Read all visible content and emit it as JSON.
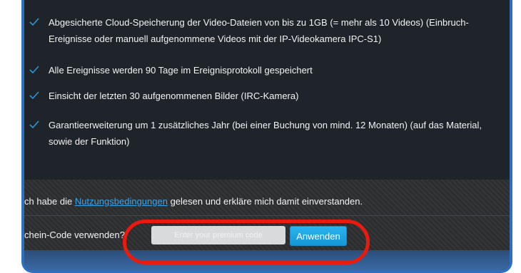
{
  "features": [
    {
      "icon": "checkmark-icon",
      "lines": [
        "Abgesicherte Cloud-Speicherung der Video-Dateien von bis zu 1GB (= mehr als 10 Videos) (Einbruch-",
        "Ereignisse oder manuell aufgenommene Videos mit der IP-Videokamera IPC-S1)"
      ]
    },
    {
      "icon": "checkmark-icon",
      "lines": [
        "Alle Ereignisse werden 90 Tage im Ereignisprotokoll gespeichert"
      ]
    },
    {
      "icon": "checkmark-icon",
      "lines": [
        "Einsicht der letzten 30 aufgenommenen Bilder (IRC-Kamera)"
      ]
    },
    {
      "icon": "checkmark-icon",
      "lines": [
        "Garantieerweiterung um 1 zusätzliches Jahr (bei einer Buchung von mind. 12 Monaten) (auf das Material,",
        "sowie der Funktion)"
      ]
    }
  ],
  "consent": {
    "before": "ch habe die ",
    "link": "Nutzungsbedingungen",
    "after": " gelesen und erkläre mich damit einverstanden."
  },
  "coupon": {
    "label": "chein-Code verwenden?",
    "input_value": "",
    "placeholder": "Enter your premium code",
    "button": "Anwenden"
  },
  "colors": {
    "panel": "#1e2429",
    "check": "#2e93d9",
    "link": "#3da4e8",
    "button": "#1fa6e6",
    "annotation": "#ea1a0e",
    "frame": "#2f6fbf"
  }
}
